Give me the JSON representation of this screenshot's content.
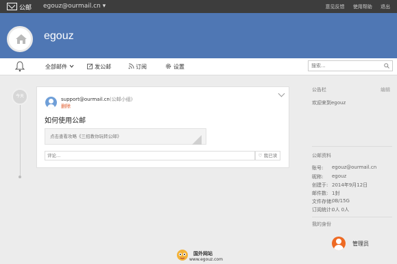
{
  "topbar": {
    "brand": "公邮",
    "account": "egouz@ourmail.cn ▾",
    "links": [
      "意见反馈",
      "使用帮助",
      "退出"
    ]
  },
  "banner": {
    "name": "egouz"
  },
  "nav": {
    "all_mail": "全部邮件",
    "compose": "发公邮",
    "subscribe": "订阅",
    "settings": "设置",
    "search_placeholder": "搜索..."
  },
  "timeline": {
    "badge": "今天"
  },
  "mail": {
    "sender": "support@ourmail.cn",
    "group": "(公邮小组)",
    "delete": "删除",
    "subject": "如何使用公邮",
    "preview": "点击查看攻略《三招教你玩转公邮》",
    "comment_placeholder": "评论...",
    "read_label": "♡ 我已读"
  },
  "sidebar": {
    "board_title": "公告栏",
    "board_edit": "编辑",
    "board_text": "欢迎来到egouz",
    "profile_title": "公邮资料",
    "profile": [
      {
        "k": "账号:",
        "v": "egouz@ourmail.cn"
      },
      {
        "k": "昵称:",
        "v": "egouz"
      },
      {
        "k": "创建于:",
        "v": "2014年9月12日"
      },
      {
        "k": "邮件数:",
        "v": "1封"
      },
      {
        "k": "文件存储:",
        "v": "0B/15G"
      },
      {
        "k": "订阅统计:",
        "v": "0人   0人"
      }
    ],
    "identity_title": "我的身份",
    "identity_role": "管理员"
  },
  "watermark": {
    "title": "国外网站",
    "url": "www.egouz.com"
  },
  "colors": {
    "banner": "#4f77b4",
    "topbar": "#3d3d3d",
    "accent": "#ee6a23"
  }
}
